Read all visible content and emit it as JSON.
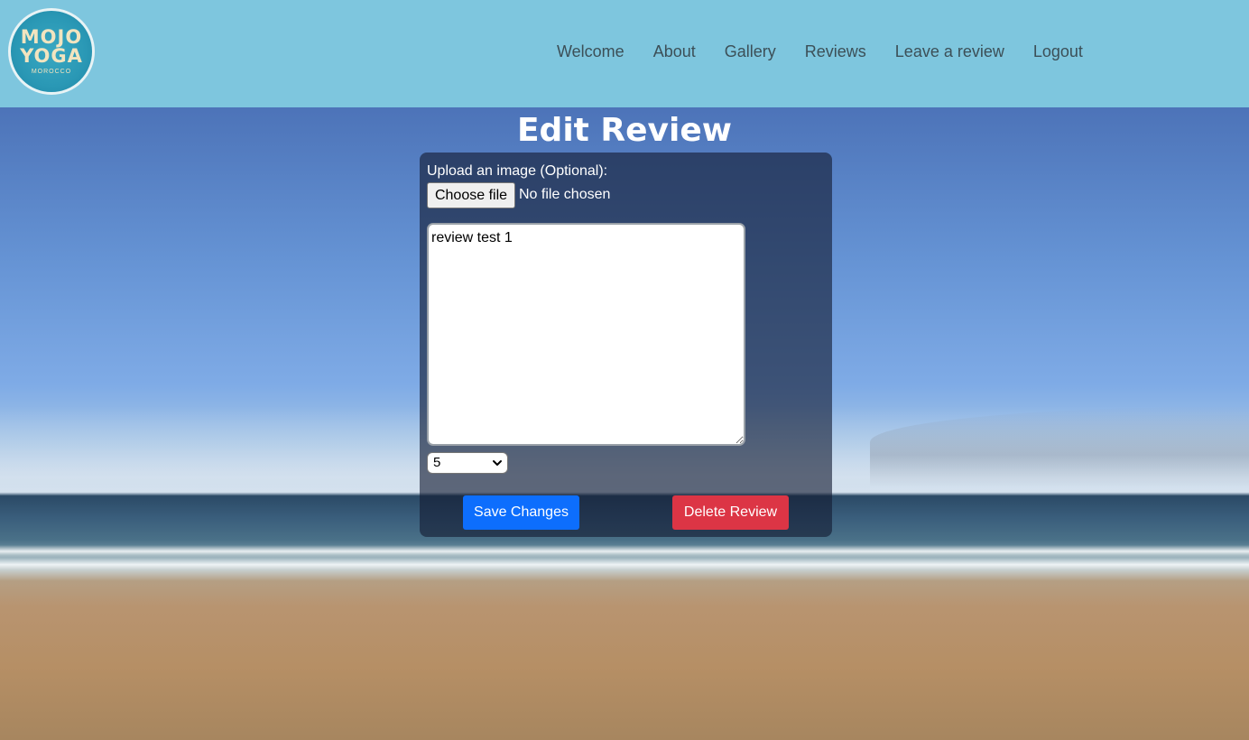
{
  "header": {
    "logo": {
      "line1": "MOJO",
      "line2": "YOGA",
      "line3": "MOROCCO"
    },
    "nav": [
      {
        "label": "Welcome"
      },
      {
        "label": "About"
      },
      {
        "label": "Gallery"
      },
      {
        "label": "Reviews"
      },
      {
        "label": "Leave a review"
      },
      {
        "label": "Logout"
      }
    ]
  },
  "page": {
    "title": "Edit Review"
  },
  "form": {
    "upload_label": "Upload an image (Optional):",
    "file_button_label": "Choose file",
    "file_status": "No file chosen",
    "review_text": "review test 1",
    "rating_value": "5",
    "save_label": "Save Changes",
    "delete_label": "Delete Review"
  },
  "colors": {
    "header_bg": "#7ec6de",
    "nav_text": "#3c4f57",
    "save_button": "#0d6efd",
    "delete_button": "#dc3545"
  },
  "icons": {
    "logo": "mojo-yoga-logo",
    "select": "chevron-down-icon"
  }
}
